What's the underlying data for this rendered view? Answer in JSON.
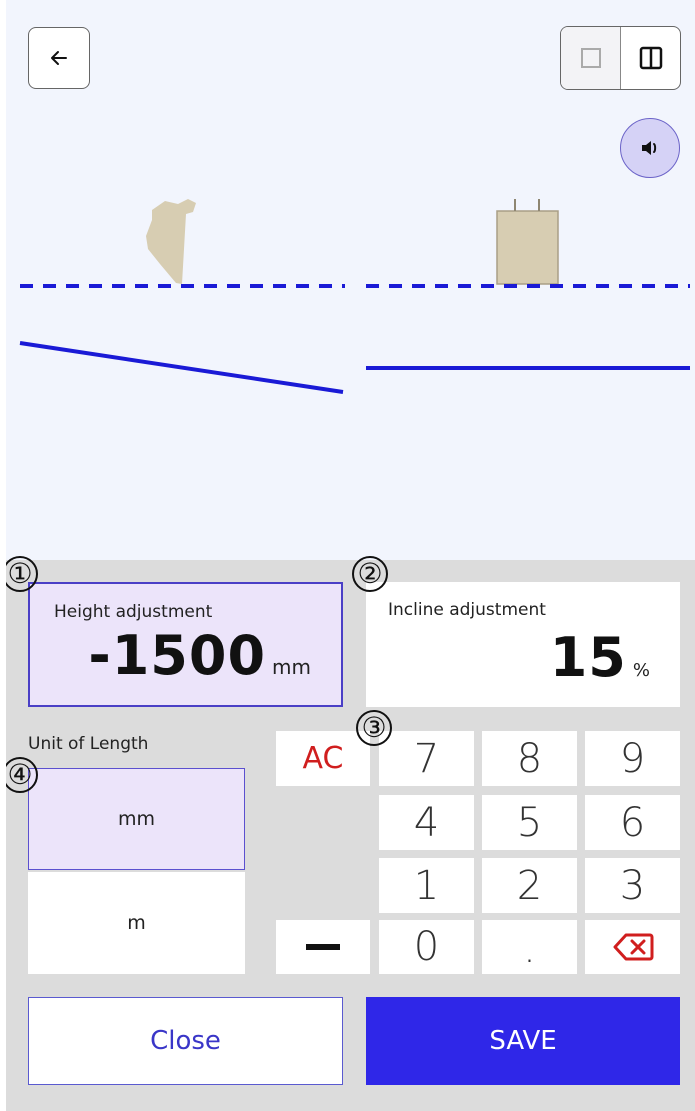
{
  "header": {
    "back_icon": "arrow-left-icon",
    "view_toggle": {
      "single_icon": "single-view-icon",
      "split_icon": "split-view-icon",
      "selected": "split"
    },
    "sound_icon": "speaker-icon"
  },
  "markers": {
    "m1": "①",
    "m2": "②",
    "m3": "③",
    "m4": "④"
  },
  "height_adjustment": {
    "label": "Height adjustment",
    "value": "-1500",
    "unit": "mm"
  },
  "incline_adjustment": {
    "label": "Incline adjustment",
    "value": "15",
    "unit": "%"
  },
  "unit_of_length": {
    "title": "Unit of Length",
    "options": [
      "mm",
      "m"
    ],
    "selected": "mm"
  },
  "keypad": {
    "clear": "AC",
    "minus": "minus-icon",
    "keys": [
      "7",
      "8",
      "9",
      "4",
      "5",
      "6",
      "1",
      "2",
      "3",
      "0",
      "."
    ],
    "backspace": "backspace-icon"
  },
  "actions": {
    "close": "Close",
    "save": "SAVE"
  },
  "colors": {
    "accent": "#2f27e8",
    "line": "#1a1ad6",
    "machine": "#d7cdb2",
    "ac": "#d01e1e"
  }
}
